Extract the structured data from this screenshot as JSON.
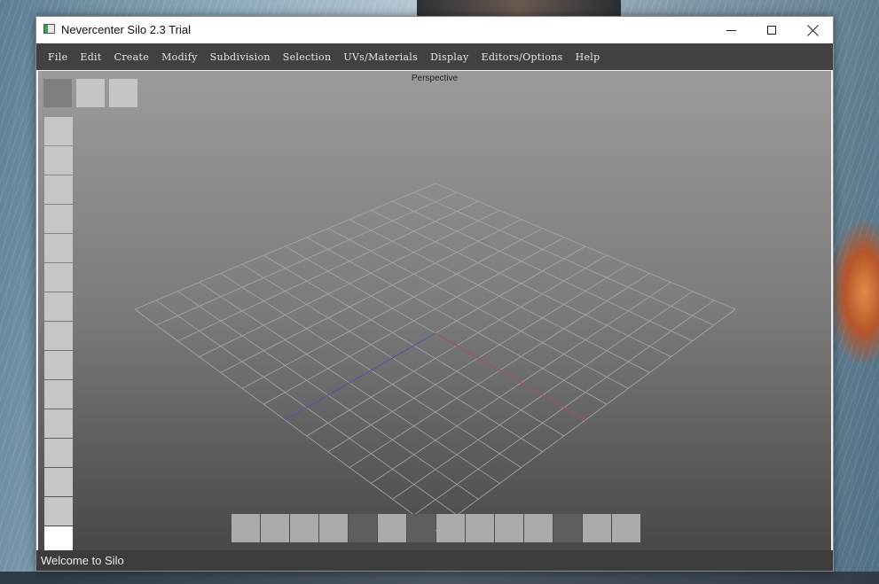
{
  "window": {
    "title": "Nevercenter Silo 2.3 Trial"
  },
  "menu": [
    "File",
    "Edit",
    "Create",
    "Modify",
    "Subdivision",
    "Selection",
    "UVs/Materials",
    "Display",
    "Editors/Options",
    "Help"
  ],
  "viewport": {
    "label": "Perspective"
  },
  "status": {
    "text": "Welcome to Silo"
  },
  "colors": {
    "menubar": "#414141",
    "statusbar": "#3c3c3c",
    "grid": "#a6a6a6",
    "axis_x": "#a34a50",
    "axis_z": "#4c4ea0"
  },
  "tools": {
    "top": [
      {
        "state": "active"
      },
      {
        "state": "normal"
      },
      {
        "state": "normal"
      }
    ],
    "side": [
      {
        "state": "normal"
      },
      {
        "state": "normal"
      },
      {
        "state": "normal"
      },
      {
        "state": "normal"
      },
      {
        "state": "normal"
      },
      {
        "state": "normal"
      },
      {
        "state": "normal"
      },
      {
        "state": "normal"
      },
      {
        "state": "normal"
      },
      {
        "state": "normal"
      },
      {
        "state": "normal"
      },
      {
        "state": "normal"
      },
      {
        "state": "normal"
      },
      {
        "state": "normal"
      },
      {
        "state": "selected"
      }
    ],
    "bottom": [
      {
        "state": "normal"
      },
      {
        "state": "normal"
      },
      {
        "state": "normal"
      },
      {
        "state": "normal"
      },
      {
        "state": "active"
      },
      {
        "state": "normal"
      },
      {
        "state": "active"
      },
      {
        "state": "normal"
      },
      {
        "state": "normal"
      },
      {
        "state": "normal"
      },
      {
        "state": "normal"
      },
      {
        "state": "active"
      },
      {
        "state": "normal"
      },
      {
        "state": "normal"
      }
    ]
  }
}
